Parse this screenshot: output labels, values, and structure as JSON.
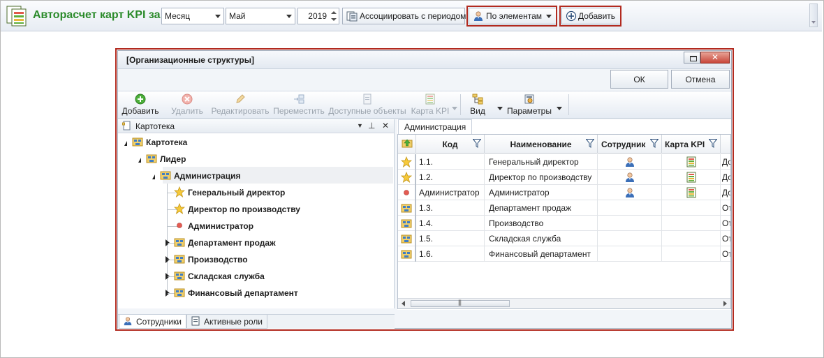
{
  "toolbar": {
    "title": "Авторасчет карт KPI за",
    "period_combo": "Месяц",
    "month_combo": "Май",
    "year_value": "2019",
    "associate_button": "Ассоциировать с периодом",
    "by_elements_button": "По элементам",
    "add_button": "Добавить"
  },
  "dialog": {
    "title": "[Организационные структуры]",
    "ok_label": "ОК",
    "cancel_label": "Отмена",
    "ribbon": {
      "add": "Добавить",
      "delete": "Удалить",
      "edit": "Редактировать",
      "move": "Переместить",
      "available": "Доступные объекты",
      "kpi_card": "Карта KPI",
      "view": "Вид",
      "params": "Параметры"
    },
    "left_panel": {
      "header": "Картотека",
      "tree": [
        {
          "label": "Картотека",
          "icon": "org-icon",
          "level": 0,
          "toggle": "open"
        },
        {
          "label": "Лидер",
          "icon": "org-icon",
          "level": 1,
          "toggle": "open"
        },
        {
          "label": "Администрация",
          "icon": "org-icon",
          "level": 2,
          "toggle": "open"
        },
        {
          "label": "Генеральный директор",
          "icon": "star-icon",
          "level": 3,
          "toggle": "none"
        },
        {
          "label": "Директор по производству",
          "icon": "star-icon",
          "level": 3,
          "toggle": "none"
        },
        {
          "label": "Администратор",
          "icon": "dot-icon",
          "level": 3,
          "toggle": "none"
        },
        {
          "label": "Департамент продаж",
          "icon": "org-icon",
          "level": 3,
          "toggle": "closed"
        },
        {
          "label": "Производство",
          "icon": "org-icon",
          "level": 3,
          "toggle": "closed"
        },
        {
          "label": "Складская служба",
          "icon": "org-icon",
          "level": 3,
          "toggle": "closed"
        },
        {
          "label": "Финансовый департамент",
          "icon": "org-icon",
          "level": 3,
          "toggle": "closed"
        }
      ],
      "bottom_tabs": [
        "Сотрудники",
        "Активные роли"
      ]
    },
    "right_panel": {
      "tab": "Администрация",
      "columns": [
        "Код",
        "Наименование",
        "Сотрудник",
        "Карта KPI"
      ],
      "rows": [
        {
          "type": "star-icon",
          "code": "1.1.",
          "name": "Генеральный директор",
          "employee": true,
          "kpi": true,
          "extra": "До"
        },
        {
          "type": "star-icon",
          "code": "1.2.",
          "name": "Директор по производству",
          "employee": true,
          "kpi": true,
          "extra": "До"
        },
        {
          "type": "dot-icon",
          "code": "Администратор",
          "name": "Администратор",
          "employee": true,
          "kpi": true,
          "extra": "До"
        },
        {
          "type": "org-icon",
          "code": "1.3.",
          "name": "Департамент продаж",
          "employee": false,
          "kpi": false,
          "extra": "От"
        },
        {
          "type": "org-icon",
          "code": "1.4.",
          "name": "Производство",
          "employee": false,
          "kpi": false,
          "extra": "От"
        },
        {
          "type": "org-icon",
          "code": "1.5.",
          "name": "Складская служба",
          "employee": false,
          "kpi": false,
          "extra": "От"
        },
        {
          "type": "org-icon",
          "code": "1.6.",
          "name": "Финансовый департамент",
          "employee": false,
          "kpi": false,
          "extra": "От"
        }
      ]
    }
  },
  "colors": {
    "title_green": "#2a8a2a",
    "highlight_red": "#b22a1f"
  }
}
